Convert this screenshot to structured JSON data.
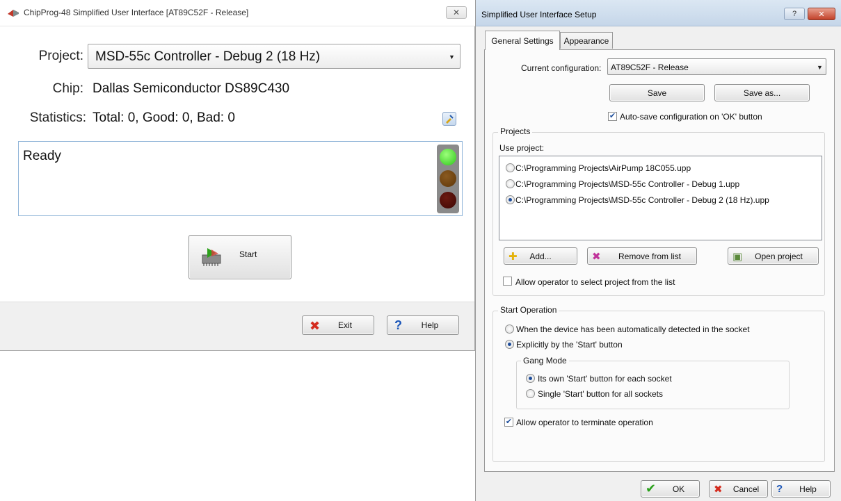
{
  "left_window": {
    "title": "ChipProg-48 Simplified User Interface [AT89C52F - Release]",
    "close_glyph": "✕",
    "project_label": "Project:",
    "project_value": "MSD-55c Controller - Debug 2 (18 Hz)",
    "chip_label": "Chip:",
    "chip_value": "Dallas Semiconductor DS89C430",
    "statistics_label": "Statistics:",
    "statistics_value": "Total: 0, Good: 0, Bad: 0",
    "status_text": "Ready",
    "status_light": "green",
    "start_label": "Start",
    "exit_label": "Exit",
    "help_label": "Help"
  },
  "right_window": {
    "title": "Simplified User Interface Setup",
    "help_glyph": "?",
    "close_glyph": "✕",
    "tabs": [
      {
        "label": "General Settings",
        "active": true
      },
      {
        "label": "Appearance",
        "active": false
      }
    ],
    "current_config_label": "Current configuration:",
    "current_config_value": "AT89C52F - Release",
    "save_label": "Save",
    "save_as_label": "Save as...",
    "autosave_label": "Auto-save configuration on 'OK' button",
    "autosave_checked": true,
    "projects_group": "Projects",
    "use_project_label": "Use project:",
    "projects": [
      {
        "path": "C:\\Programming Projects\\AirPump 18C055.upp",
        "selected": false
      },
      {
        "path": "C:\\Programming Projects\\MSD-55c Controller - Debug 1.upp",
        "selected": false
      },
      {
        "path": "C:\\Programming Projects\\MSD-55c Controller - Debug 2 (18 Hz).upp",
        "selected": true
      }
    ],
    "add_label": "Add...",
    "remove_label": "Remove from list",
    "open_project_label": "Open project",
    "allow_select_label": "Allow operator to select project from the list",
    "allow_select_checked": false,
    "start_group": "Start Operation",
    "start_auto_label": "When the device has been automatically detected in the socket",
    "start_explicit_label": "Explicitly by the 'Start' button",
    "gang_group": "Gang Mode",
    "gang_own_label": "Its own 'Start' button for each socket",
    "gang_single_label": "Single 'Start' button for all sockets",
    "allow_terminate_label": "Allow operator to terminate operation",
    "allow_terminate_checked": true,
    "ok_label": "OK",
    "cancel_label": "Cancel",
    "help_label": "Help"
  },
  "colors": {
    "light_green": "#3fdc1f",
    "light_amber_off": "#6a3d0c",
    "light_red_off": "#4a0c06",
    "accent_blue": "#1d4c9a"
  }
}
